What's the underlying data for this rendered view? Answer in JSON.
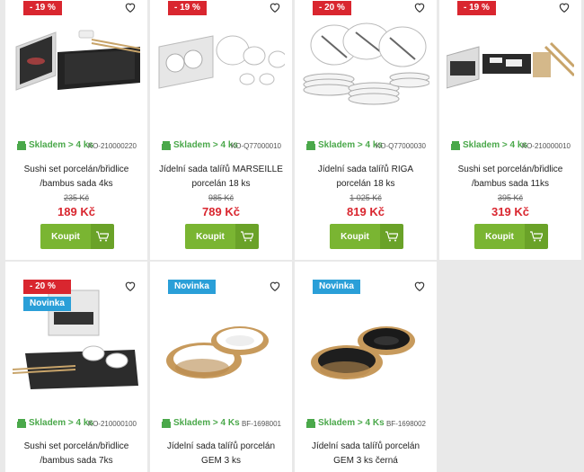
{
  "products": [
    {
      "badges": [
        {
          "type": "sale",
          "text": "- 19 %"
        }
      ],
      "stock": "Skladem > 4 ks",
      "code": "KO-210000220",
      "title_line1": "Sushi set porcelán/břidlice",
      "title_line2": "/bambus sada 4ks",
      "old_price": "235 Kč",
      "price": "189 Kč",
      "button": "Koupit",
      "image": "sushi-set-slate-bamboo"
    },
    {
      "badges": [
        {
          "type": "sale",
          "text": "- 19 %"
        }
      ],
      "stock": "Skladem > 4 ks",
      "code": "KO-Q77000010",
      "title_line1": "Jídelní sada talířů MARSEILLE",
      "title_line2": "porcelán 18 ks",
      "old_price": "985 Kč",
      "price": "789 Kč",
      "button": "Koupit",
      "image": "plate-set-white-box"
    },
    {
      "badges": [
        {
          "type": "sale",
          "text": "- 20 %"
        }
      ],
      "stock": "Skladem > 4 ks",
      "code": "KO-Q77000030",
      "title_line1": "Jídelní sada talířů RIGA",
      "title_line2": "porcelán 18 ks",
      "old_price": "1 025 Kč",
      "price": "819 Kč",
      "button": "Koupit",
      "image": "plate-stacks-stripes"
    },
    {
      "badges": [
        {
          "type": "sale",
          "text": "- 19 %"
        }
      ],
      "stock": "Skladem > 4 ks",
      "code": "KO-210000010",
      "title_line1": "Sushi set porcelán/břidlice",
      "title_line2": "/bambus sada 11ks",
      "old_price": "395 Kč",
      "price": "319 Kč",
      "button": "Koupit",
      "image": "sushi-set-11-pieces"
    },
    {
      "badges": [
        {
          "type": "sale",
          "text": "- 20 %"
        },
        {
          "type": "new",
          "text": "Novinka"
        }
      ],
      "stock": "Skladem > 4 ks",
      "code": "KO-210000100",
      "title_line1": "Sushi set porcelán/břidlice",
      "title_line2": "/bambus sada 7ks",
      "image": "sushi-set-bowls-slate"
    },
    {
      "badges": [
        {
          "type": "new",
          "text": "Novinka"
        }
      ],
      "stock": "Skladem > 4 Ks",
      "code": "BF-1698001",
      "title_line1": "Jídelní sada talířů porcelán",
      "title_line2": "GEM 3 ks",
      "image": "gold-white-plates"
    },
    {
      "badges": [
        {
          "type": "new",
          "text": "Novinka"
        }
      ],
      "stock": "Skladem > 4 Ks",
      "code": "BF-1698002",
      "title_line1": "Jídelní sada talířů porcelán",
      "title_line2": "GEM 3 ks černá",
      "image": "gold-black-plates"
    }
  ],
  "colors": {
    "sale": "#d9262f",
    "new": "#2a9fd8",
    "stock": "#4aa84a",
    "button": "#7ab532",
    "price": "#d9262f"
  },
  "icons": {
    "favorite": "heart-outline-icon",
    "stock": "box-icon",
    "cart": "cart-icon"
  }
}
